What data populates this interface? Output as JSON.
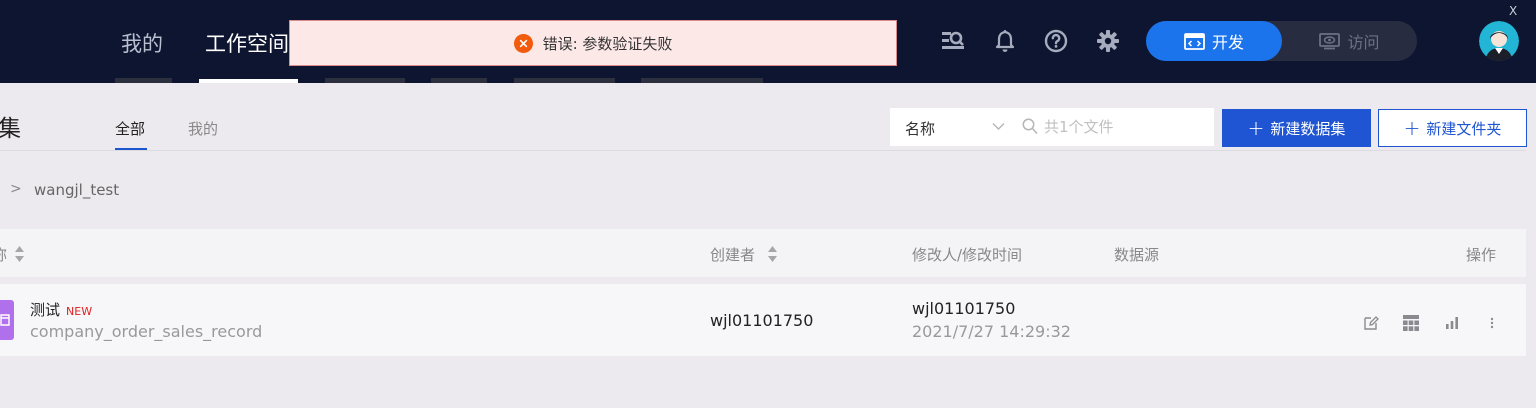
{
  "nav": {
    "mine": "我的",
    "workspace": "工作空间",
    "icons": [
      "data-search-icon",
      "bell-icon",
      "help-icon",
      "gear-icon"
    ],
    "mode": {
      "dev": "开发",
      "visit": "访问",
      "dev_icon": "code-window-icon",
      "visit_icon": "eye-screen-icon"
    },
    "avatar_icon": "user-avatar",
    "close": "X"
  },
  "toast": {
    "icon": "error-circle-icon",
    "message": "错误: 参数验证失败"
  },
  "page": {
    "title": "集"
  },
  "tabs": [
    "全部",
    "我的"
  ],
  "filter": {
    "field": "名称",
    "placeholder": "共1个文件"
  },
  "actions": {
    "new_dataset": "新建数据集",
    "new_folder": "新建文件夹",
    "plus": "+"
  },
  "breadcrumb": {
    "separator": ">",
    "current": "wangjl_test"
  },
  "table": {
    "headers": {
      "name": "称",
      "creator": "创建者",
      "modified": "修改人/修改时间",
      "source": "数据源",
      "operations": "操作"
    },
    "rows": [
      {
        "name": "测试",
        "badge": "NEW",
        "table": "company_order_sales_record",
        "creator": "wjl01101750",
        "modifier": "wjl01101750",
        "modified_time": "2021/7/27 14:29:32",
        "source": "",
        "actions": [
          "edit-icon",
          "table-grid-icon",
          "bar-chart-icon",
          "more-icon"
        ]
      }
    ]
  },
  "colors": {
    "topbar": "#0e1530",
    "primary": "#1f55d2",
    "mode_active": "#1b74ec",
    "error": "#f25a0c",
    "toast_bg": "#fde8e8",
    "dataset_icon": "#b070ec",
    "new_badge": "#e02020"
  }
}
